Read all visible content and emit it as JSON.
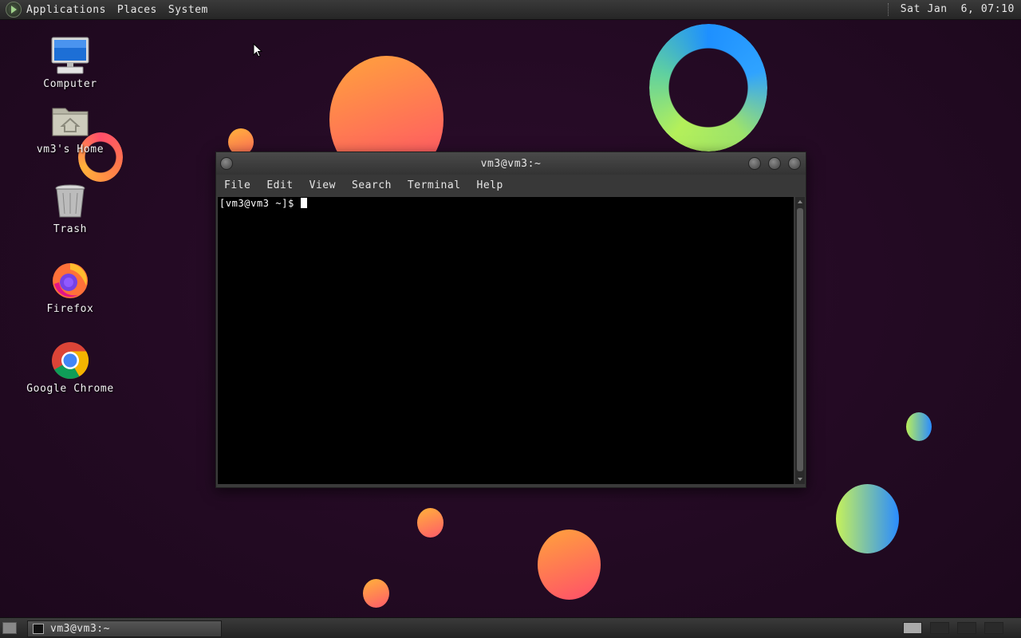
{
  "top_panel": {
    "menus": [
      "Applications",
      "Places",
      "System"
    ],
    "clock": "Sat Jan  6, 07:10"
  },
  "desktop": {
    "icons": [
      {
        "label": "Computer",
        "icon": "computer-icon"
      },
      {
        "label": "vm3's Home",
        "icon": "home-folder-icon"
      },
      {
        "label": "Trash",
        "icon": "trash-icon"
      },
      {
        "label": "Firefox",
        "icon": "firefox-icon"
      },
      {
        "label": "Google Chrome",
        "icon": "chrome-icon"
      }
    ]
  },
  "terminal": {
    "title": "vm3@vm3:~",
    "menus": [
      "File",
      "Edit",
      "View",
      "Search",
      "Terminal",
      "Help"
    ],
    "prompt": "[vm3@vm3 ~]$"
  },
  "bottom_panel": {
    "task_label": "vm3@vm3:~"
  },
  "colors": {
    "background": "#230a23",
    "terminal_bg": "#000000",
    "panel": "#2e2e2e"
  }
}
